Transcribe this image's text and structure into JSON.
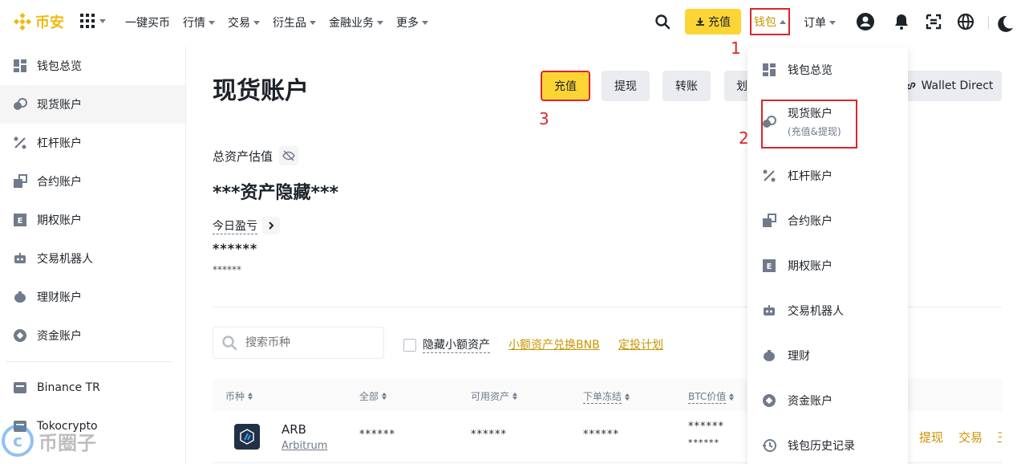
{
  "nav": {
    "brand": "币安",
    "items": [
      "一键买币",
      "行情",
      "交易",
      "衍生品",
      "金融业务",
      "更多"
    ],
    "deposit": "充值",
    "wallet": "钱包",
    "orders": "订单"
  },
  "annotations": {
    "one": "1",
    "two": "2",
    "three": "3"
  },
  "sidebar": {
    "items": [
      "钱包总览",
      "现货账户",
      "杠杆账户",
      "合约账户",
      "期权账户",
      "交易机器人",
      "理财账户",
      "资金账户"
    ],
    "extra": [
      "Binance TR",
      "Tokocrypto"
    ]
  },
  "main": {
    "title": "现货账户",
    "actions": [
      "充值",
      "提现",
      "转账",
      "划"
    ],
    "wallet_direct": "Wallet Direct",
    "est_label": "总资产估值",
    "hidden_value": "***资产隐藏***",
    "pnl_label": "今日盈亏",
    "pnl_value": "******",
    "pnl_sub": "******",
    "search_placeholder": "搜索币种",
    "hide_small": "隐藏小额资产",
    "convert_bnb": "小额资产兑换BNB",
    "auto_invest": "定投计划"
  },
  "table": {
    "headers": [
      "币种",
      "全部",
      "可用资产",
      "下单冻结",
      "BTC价值"
    ],
    "row": {
      "symbol": "ARB",
      "name": "Arbitrum",
      "total": "******",
      "available": "******",
      "frozen": "******",
      "btc1": "******",
      "btc2": "******",
      "withdraw": "提现",
      "trade": "交易",
      "more": "王"
    }
  },
  "dropdown": {
    "items": [
      "钱包总览",
      "现货账户",
      "杠杆账户",
      "合约账户",
      "期权账户",
      "交易机器人",
      "理财",
      "资金账户",
      "钱包历史记录"
    ],
    "spot_sub": "(充值&提现)"
  },
  "watermark": "币圈子",
  "colors": {
    "accent": "#fcd535",
    "brand": "#f0b90b",
    "link": "#c99400",
    "annotation": "#d9262c"
  }
}
